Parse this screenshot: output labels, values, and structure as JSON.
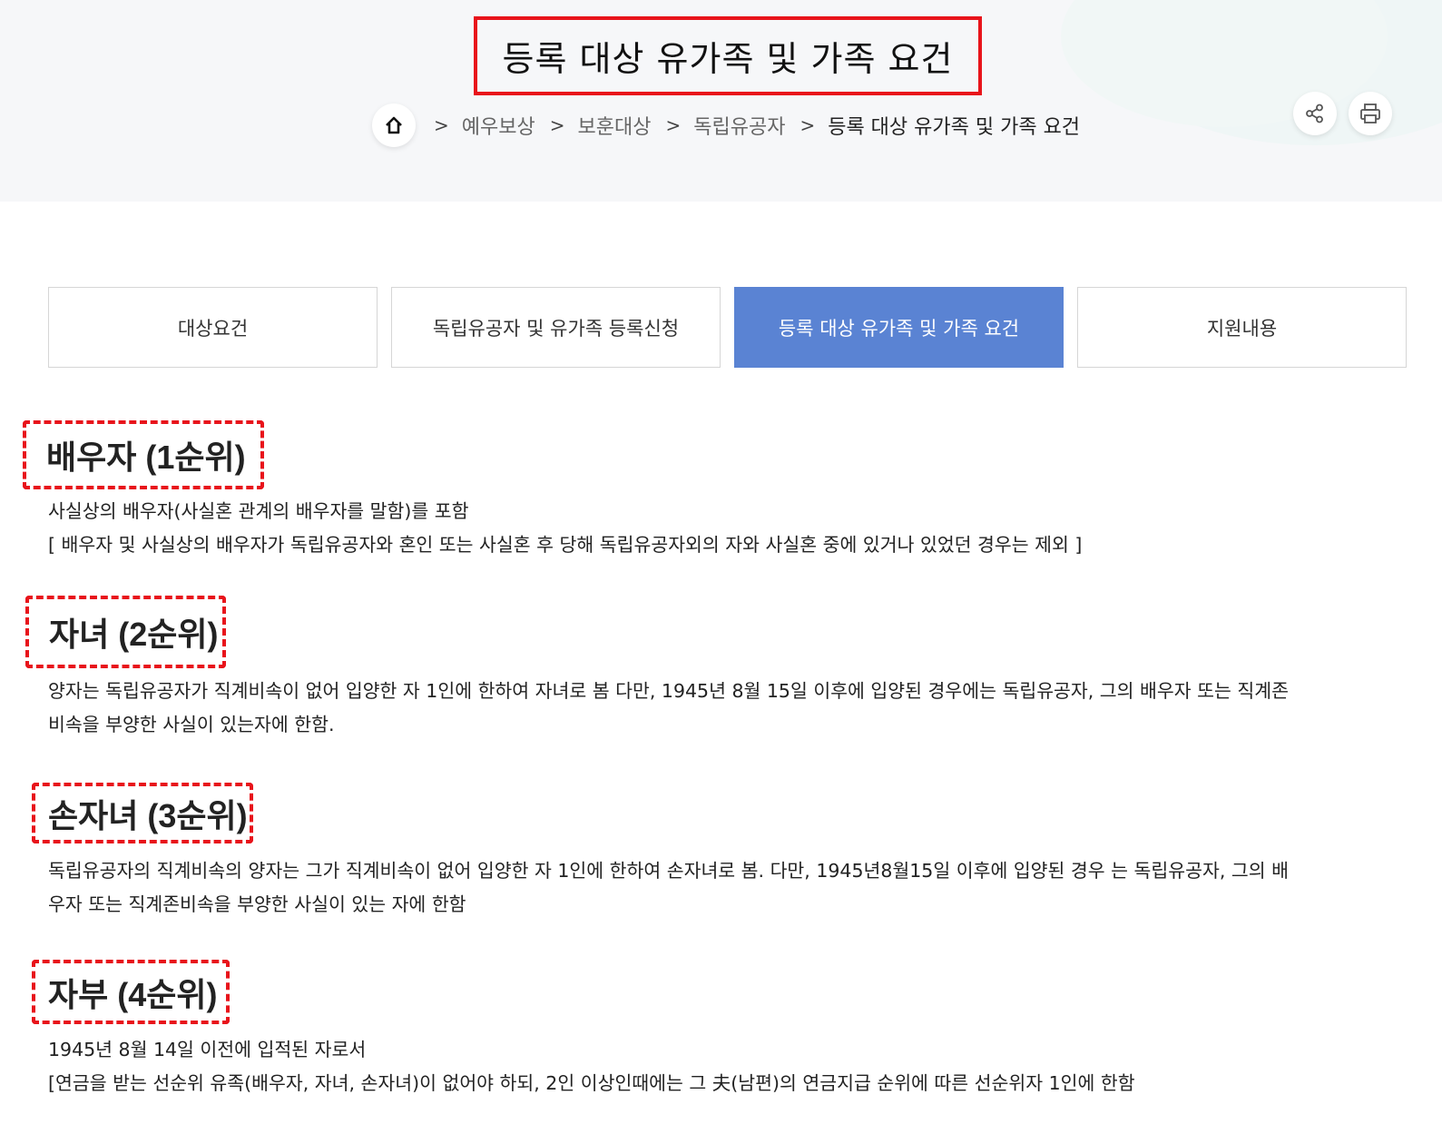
{
  "header": {
    "title": "등록 대상 유가족 및 가족 요건",
    "breadcrumb": [
      "예우보상",
      "보훈대상",
      "독립유공자",
      "등록 대상 유가족 및 가족 요건"
    ]
  },
  "tools": {
    "share_icon": "share-icon",
    "print_icon": "print-icon"
  },
  "tabs": [
    {
      "label": "대상요건",
      "active": false
    },
    {
      "label": "독립유공자 및 유가족 등록신청",
      "active": false
    },
    {
      "label": "등록 대상 유가족 및 가족 요건",
      "active": true
    },
    {
      "label": "지원내용",
      "active": false
    }
  ],
  "sections": [
    {
      "title": "배우자 (1순위)",
      "lines": [
        "사실상의 배우자(사실혼 관계의 배우자를 말함)를 포함",
        "[ 배우자 및 사실상의 배우자가 독립유공자와 혼인 또는 사실혼 후 당해 독립유공자외의 자와 사실혼 중에 있거나 있었던 경우는 제외 ]"
      ]
    },
    {
      "title": "자녀 (2순위)",
      "lines": [
        "양자는 독립유공자가 직계비속이 없어 입양한 자 1인에 한하여 자녀로 봄 다만, 1945년 8월 15일 이후에 입양된 경우에는 독립유공자, 그의 배우자 또는 직계존",
        "비속을 부양한 사실이 있는자에 한함."
      ]
    },
    {
      "title": "손자녀 (3순위)",
      "lines": [
        "독립유공자의 직계비속의 양자는 그가 직계비속이 없어 입양한 자 1인에 한하여 손자녀로 봄. 다만, 1945년8월15일 이후에 입양된 경우 는 독립유공자, 그의 배",
        "우자 또는 직계존비속을 부양한 사실이 있는 자에 한함"
      ]
    },
    {
      "title": "자부 (4순위)",
      "lines": [
        "1945년 8월 14일 이전에 입적된 자로서",
        "[연금을 받는 선순위 유족(배우자, 자녀, 손자녀)이 없어야 하되, 2인 이상인때에는 그 夫(남편)의 연금지급 순위에 따른 선순위자 1인에 한함"
      ]
    }
  ],
  "colors": {
    "accent": "#5a83d3",
    "highlight": "#e8141b"
  }
}
